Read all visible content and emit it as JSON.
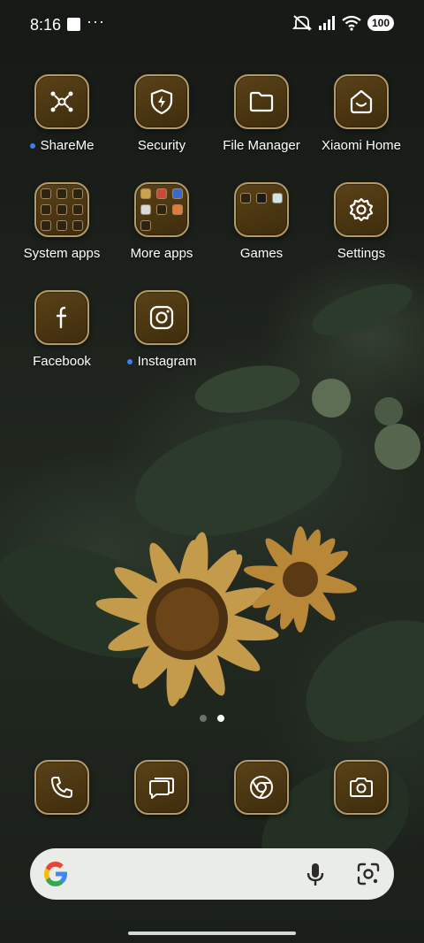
{
  "status_bar": {
    "time": "8:16",
    "overflow": "···",
    "battery": "100",
    "icons": [
      "notification-square-icon",
      "mute-icon",
      "signal-icon",
      "wifi-icon",
      "battery-icon"
    ]
  },
  "apps": [
    {
      "label": "ShareMe",
      "icon": "shareme-icon",
      "new": true
    },
    {
      "label": "Security",
      "icon": "shield-bolt-icon",
      "new": false
    },
    {
      "label": "File Manager",
      "icon": "folder-icon",
      "new": false
    },
    {
      "label": "Xiaomi Home",
      "icon": "home-smile-icon",
      "new": false
    },
    {
      "label": "System apps",
      "icon": "folder-system-apps-icon",
      "new": false
    },
    {
      "label": "More apps",
      "icon": "folder-more-apps-icon",
      "new": false
    },
    {
      "label": "Games",
      "icon": "folder-games-icon",
      "new": false
    },
    {
      "label": "Settings",
      "icon": "gear-icon",
      "new": false
    },
    {
      "label": "Facebook",
      "icon": "facebook-icon",
      "new": false
    },
    {
      "label": "Instagram",
      "icon": "instagram-icon",
      "new": true
    }
  ],
  "page_indicator": {
    "pages": 2,
    "current": 2
  },
  "dock": [
    "phone-icon",
    "messages-icon",
    "chrome-icon",
    "camera-icon"
  ],
  "search": {
    "icons": [
      "google-logo-icon",
      "microphone-icon",
      "google-lens-icon"
    ]
  },
  "colors": {
    "icon_bg": "#4a3510",
    "icon_border": "#b49a6a",
    "search_bg": "#e9ece7",
    "accent_dot": "#3d7ef2"
  }
}
